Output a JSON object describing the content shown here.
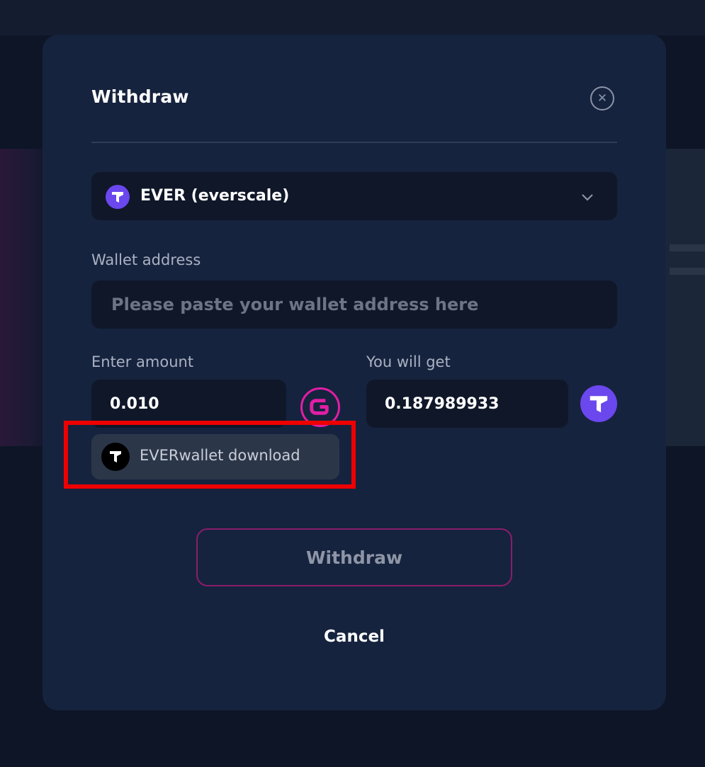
{
  "modal": {
    "title": "Withdraw",
    "close_icon": "close-circle-icon"
  },
  "token_select": {
    "selected": "EVER (everscale)",
    "icon": "ever-token-icon",
    "chevron_icon": "chevron-down-icon"
  },
  "wallet": {
    "label": "Wallet address",
    "placeholder": "Please paste your wallet address here",
    "value": ""
  },
  "amount": {
    "label": "Enter amount",
    "value": "0.010",
    "coin_icon": "g-coin-icon"
  },
  "receive": {
    "label": "You will get",
    "value": "0.187989933",
    "coin_icon": "ever-token-icon"
  },
  "download": {
    "label": "EVERwallet download",
    "icon": "everwallet-logo-icon"
  },
  "actions": {
    "withdraw_label": "Withdraw",
    "cancel_label": "Cancel"
  },
  "colors": {
    "modal_bg": "#16233e",
    "field_bg": "#0f1729",
    "accent_magenta": "#e11ea5",
    "ever_purple": "#6b47ee",
    "highlight_red": "#ee0000"
  }
}
